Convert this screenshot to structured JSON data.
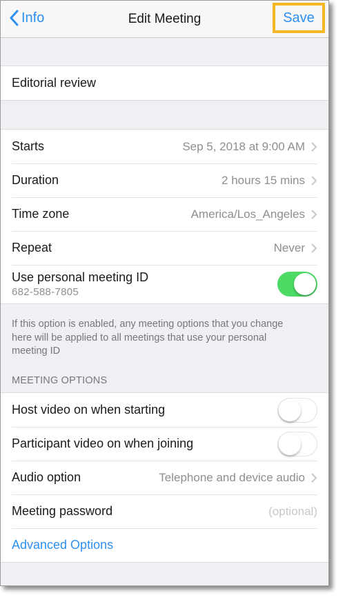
{
  "navbar": {
    "back_label": "Info",
    "title": "Edit Meeting",
    "save_label": "Save"
  },
  "topic": {
    "value": "Editorial review"
  },
  "schedule": {
    "rows": [
      {
        "label": "Starts",
        "value": "Sep 5, 2018 at 9:00 AM"
      },
      {
        "label": "Duration",
        "value": "2 hours 15 mins"
      },
      {
        "label": "Time zone",
        "value": "America/Los_Angeles"
      },
      {
        "label": "Repeat",
        "value": "Never"
      }
    ],
    "personal_id": {
      "label": "Use personal meeting ID",
      "id": "682-588-7805",
      "enabled": true
    }
  },
  "footnote": "If this option is enabled, any meeting options that you change here will be applied to all meetings that use your personal meeting ID",
  "meeting_options": {
    "header": "MEETING OPTIONS",
    "host_video": {
      "label": "Host video on when starting",
      "enabled": false
    },
    "participant_video": {
      "label": "Participant video on when joining",
      "enabled": false
    },
    "audio": {
      "label": "Audio option",
      "value": "Telephone and device audio"
    },
    "password": {
      "label": "Meeting password",
      "placeholder": "(optional)"
    },
    "advanced_label": "Advanced Options"
  },
  "colors": {
    "accent": "#2d8ff0",
    "toggle_on": "#4cd964",
    "highlight": "#f5b724"
  }
}
